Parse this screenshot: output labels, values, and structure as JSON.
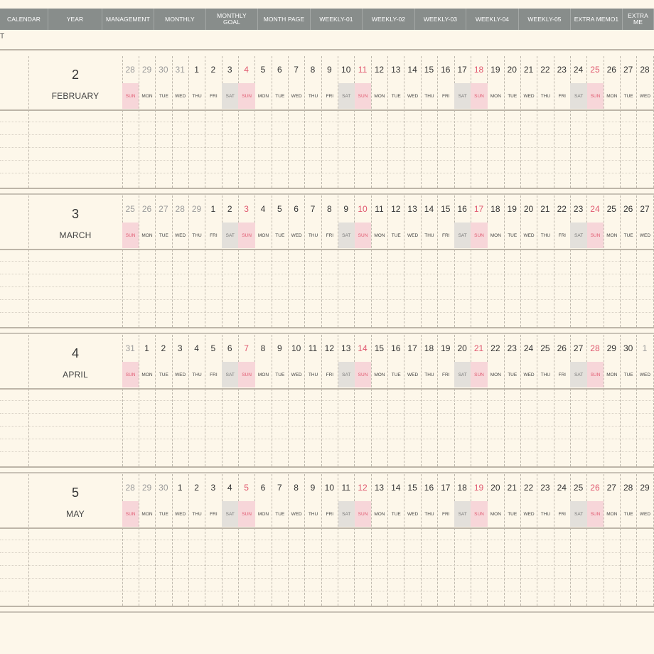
{
  "nav": {
    "tabs": [
      "CALENDAR",
      "YEAR",
      "MANAGEMENT",
      "MONTHLY",
      "MONTHLY\nGOAL",
      "MONTH PAGE",
      "WEEKLY-01",
      "WEEKLY-02",
      "WEEKLY-03",
      "WEEKLY-04",
      "WEEKLY-05",
      "EXTRA MEMO1",
      "EXTRA ME"
    ]
  },
  "top_mark": "T",
  "colors": {
    "background": "#fdf7ea",
    "nav": "#888d8b",
    "sunday_fill": "#f7d6d9",
    "saturday_fill": "#e3e0db",
    "accent_red": "#e0586f"
  },
  "months": [
    {
      "number": "2",
      "name": "FEBRUARY",
      "days": [
        28,
        29,
        30,
        31,
        1,
        2,
        3,
        4,
        5,
        6,
        7,
        8,
        9,
        10,
        11,
        12,
        13,
        14,
        15,
        16,
        17,
        18,
        19,
        20,
        21,
        22,
        23,
        24,
        25,
        26,
        27,
        28
      ],
      "prev_days": 4,
      "weekdays": [
        "SUN",
        "MON",
        "TUE",
        "WED",
        "THU",
        "FRI",
        "SAT",
        "SUN",
        "MON",
        "TUE",
        "WED",
        "THU",
        "FRI",
        "SAT",
        "SUN",
        "MON",
        "TUE",
        "WED",
        "THU",
        "FRI",
        "SAT",
        "SUN",
        "MON",
        "TUE",
        "WED",
        "THU",
        "FRI",
        "SAT",
        "SUN",
        "MON",
        "TUE",
        "WED"
      ]
    },
    {
      "number": "3",
      "name": "MARCH",
      "days": [
        25,
        26,
        27,
        28,
        29,
        1,
        2,
        3,
        4,
        5,
        6,
        7,
        8,
        9,
        10,
        11,
        12,
        13,
        14,
        15,
        16,
        17,
        18,
        19,
        20,
        21,
        22,
        23,
        24,
        25,
        26,
        27
      ],
      "prev_days": 5,
      "weekdays": [
        "SUN",
        "MON",
        "TUE",
        "WED",
        "THU",
        "FRI",
        "SAT",
        "SUN",
        "MON",
        "TUE",
        "WED",
        "THU",
        "FRI",
        "SAT",
        "SUN",
        "MON",
        "TUE",
        "WED",
        "THU",
        "FRI",
        "SAT",
        "SUN",
        "MON",
        "TUE",
        "WED",
        "THU",
        "FRI",
        "SAT",
        "SUN",
        "MON",
        "TUE",
        "WED"
      ]
    },
    {
      "number": "4",
      "name": "APRIL",
      "days": [
        31,
        1,
        2,
        3,
        4,
        5,
        6,
        7,
        8,
        9,
        10,
        11,
        12,
        13,
        14,
        15,
        16,
        17,
        18,
        19,
        20,
        21,
        22,
        23,
        24,
        25,
        26,
        27,
        28,
        29,
        30,
        1
      ],
      "prev_days": 1,
      "next_days": 1,
      "weekdays": [
        "SUN",
        "MON",
        "TUE",
        "WED",
        "THU",
        "FRI",
        "SAT",
        "SUN",
        "MON",
        "TUE",
        "WED",
        "THU",
        "FRI",
        "SAT",
        "SUN",
        "MON",
        "TUE",
        "WED",
        "THU",
        "FRI",
        "SAT",
        "SUN",
        "MON",
        "TUE",
        "WED",
        "THU",
        "FRI",
        "SAT",
        "SUN",
        "MON",
        "TUE",
        "WED"
      ]
    },
    {
      "number": "5",
      "name": "MAY",
      "days": [
        28,
        29,
        30,
        1,
        2,
        3,
        4,
        5,
        6,
        7,
        8,
        9,
        10,
        11,
        12,
        13,
        14,
        15,
        16,
        17,
        18,
        19,
        20,
        21,
        22,
        23,
        24,
        25,
        26,
        27,
        28,
        29
      ],
      "prev_days": 3,
      "weekdays": [
        "SUN",
        "MON",
        "TUE",
        "WED",
        "THU",
        "FRI",
        "SAT",
        "SUN",
        "MON",
        "TUE",
        "WED",
        "THU",
        "FRI",
        "SAT",
        "SUN",
        "MON",
        "TUE",
        "WED",
        "THU",
        "FRI",
        "SAT",
        "SUN",
        "MON",
        "TUE",
        "WED",
        "THU",
        "FRI",
        "SAT",
        "SUN",
        "MON",
        "TUE",
        "WED"
      ]
    }
  ]
}
